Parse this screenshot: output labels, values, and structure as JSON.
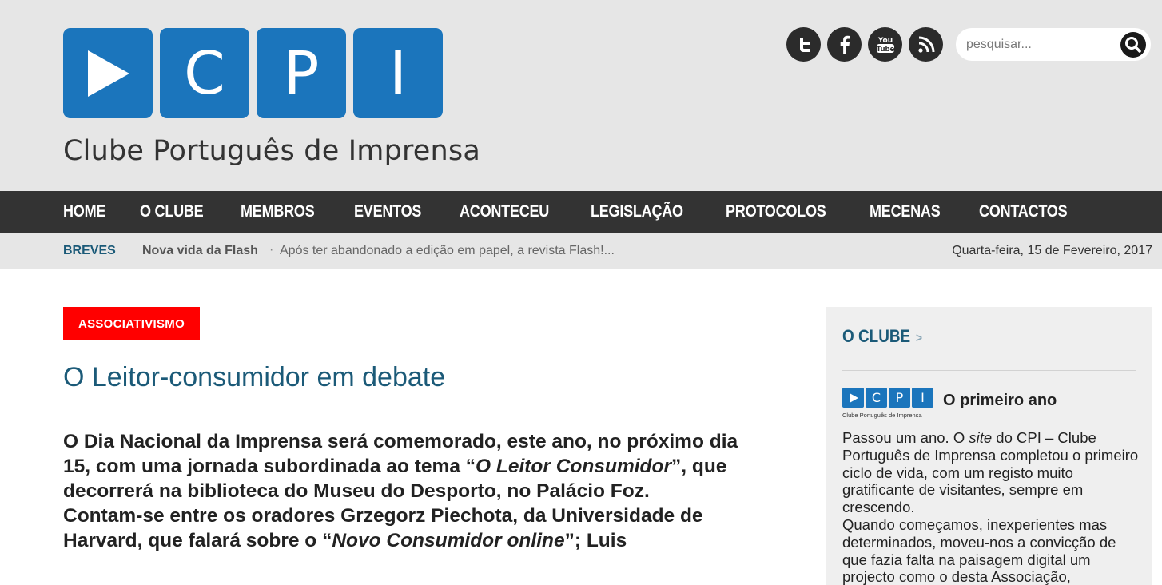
{
  "header": {
    "logo": {
      "tiles": [
        "C",
        "P",
        "I"
      ],
      "subtitle": "Clube Português de Imprensa"
    },
    "social": [
      {
        "icon": "twitter-icon"
      },
      {
        "icon": "facebook-icon"
      },
      {
        "icon": "youtube-icon"
      },
      {
        "icon": "rss-icon"
      }
    ],
    "search": {
      "placeholder": "pesquisar..."
    }
  },
  "nav": {
    "items": [
      "HOME",
      "O CLUBE",
      "MEMBROS",
      "EVENTOS",
      "ACONTECEU",
      "LEGISLAÇÃO",
      "PROTOCOLOS",
      "MECENAS",
      "CONTACTOS"
    ]
  },
  "breves": {
    "label": "BREVES",
    "title": "Nova vida da Flash",
    "separator": "·",
    "excerpt": "Após ter abandonado a edição em papel, a revista Flash!...",
    "date": "Quarta-feira, 15 de Fevereiro, 2017"
  },
  "article": {
    "tag": "ASSOCIATIVISMO",
    "title": "O Leitor-consumidor em debate",
    "p1_a": "O Dia Nacional da Imprensa será comemorado, este ano, no próximo dia 15, com uma jornada subordinada ao tema “",
    "p1_em": "O Leitor Consumidor",
    "p1_b": "”, que decorrerá na biblioteca do Museu do Desporto, no Palácio Foz.",
    "p2_a": "Contam-se entre os oradores Grzegorz Piechota, da Universidade de Harvard, que falará sobre o “",
    "p2_em": "Novo Consumidor online",
    "p2_b": "”; Luis"
  },
  "sidebar": {
    "heading": "O CLUBE",
    "chevron": ">",
    "mini_logo": {
      "tiles": [
        "C",
        "P",
        "I"
      ],
      "subtitle": "Clube Português de Imprensa"
    },
    "post_title": "O primeiro ano",
    "text_a": "Passou um ano. O ",
    "text_em": "site",
    "text_b": " do CPI – Clube Português de Imprensa completou o primeiro ciclo de vida, com um registo muito gratificante de visitantes, sempre em crescendo.",
    "text_c": "Quando começamos, inexperientes mas determinados, moveu-nos a convicção de que fazia falta na paisagem digital um projecto como o desta Associação,"
  },
  "colors": {
    "brand_blue": "#1b75bc",
    "nav_bg": "#333333",
    "tag_red": "#ff0000",
    "title_blue": "#1b5a78"
  }
}
